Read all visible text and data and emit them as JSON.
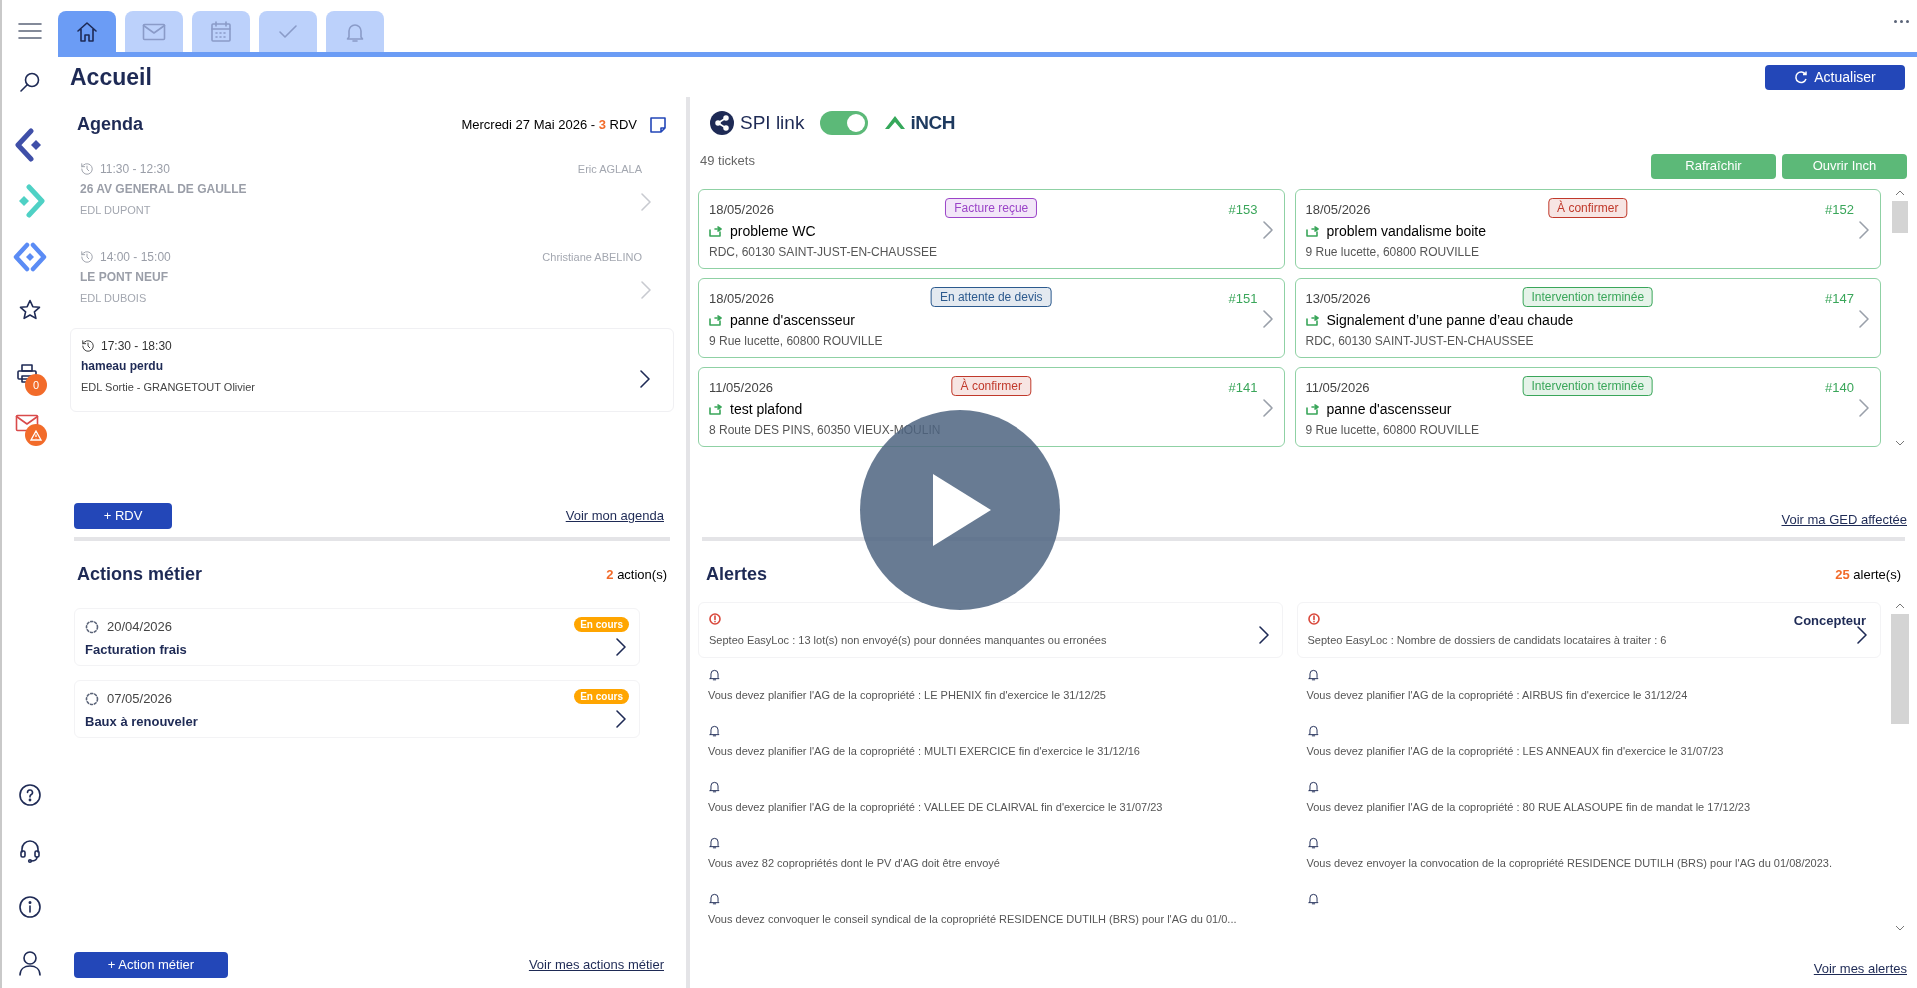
{
  "tabs": [
    {
      "kind": "home",
      "selected": true
    },
    {
      "kind": "mail",
      "selected": false
    },
    {
      "kind": "calendar",
      "selected": false
    },
    {
      "kind": "check",
      "selected": false
    },
    {
      "kind": "bell",
      "selected": false
    }
  ],
  "sidebar": {
    "print_badge": "0"
  },
  "page_title": "Accueil",
  "refresh_button": "Actualiser",
  "agenda": {
    "title": "Agenda",
    "date": "Mercredi 27 Mai 2026 -",
    "count": "3",
    "count_suffix": "RDV",
    "events": [
      {
        "time": "11:30 - 12:30",
        "person": "Eric AGLALA",
        "place": "26 AV GENERAL DE GAULLE",
        "detail": "EDL DUPONT",
        "past": true
      },
      {
        "time": "14:00 - 15:00",
        "person": "Christiane ABELINO",
        "place": "LE PONT NEUF",
        "detail": "EDL DUBOIS",
        "past": true
      },
      {
        "time": "17:30 - 18:30",
        "place": "hameau perdu",
        "detail": "EDL Sortie - GRANGETOUT Olivier",
        "past": false
      }
    ],
    "add_button": "+ RDV",
    "link": "Voir mon agenda"
  },
  "tickets": {
    "brand": "SPI link",
    "sync_on": true,
    "partner": "iNCH",
    "count": "49 tickets",
    "buttons": [
      "Rafraîchir",
      "Ouvrir Inch"
    ],
    "items": [
      {
        "date": "18/05/2026",
        "status": "Facture reçue",
        "color": "#9b44c8",
        "number": "#153",
        "title": "probleme WC",
        "address": "RDC, 60130 SAINT-JUST-EN-CHAUSSEE"
      },
      {
        "date": "18/05/2026",
        "status": "À confirmer",
        "color": "#c0392b",
        "number": "#152",
        "title": "problem vandalisme boite",
        "address": "9 Rue lucette, 60800 ROUVILLE"
      },
      {
        "date": "18/05/2026",
        "status": "En attente de devis",
        "color": "#2c5a8e",
        "number": "#151",
        "title": "panne d'ascensseur",
        "address": "9 Rue lucette, 60800 ROUVILLE"
      },
      {
        "date": "13/05/2026",
        "status": "Intervention terminée",
        "color": "#3aa65a",
        "number": "#147",
        "title": "Signalement d’une panne d’eau chaude",
        "address": "RDC, 60130 SAINT-JUST-EN-CHAUSSEE"
      },
      {
        "date": "11/05/2026",
        "status": "À confirmer",
        "color": "#c0392b",
        "number": "#141",
        "title": "test plafond",
        "address": "8 Route DES PINS, 60350 VIEUX-MOULIN"
      },
      {
        "date": "11/05/2026",
        "status": "Intervention terminée",
        "color": "#3aa65a",
        "number": "#140",
        "title": "panne d'ascensseur",
        "address": "9 Rue lucette, 60800 ROUVILLE"
      }
    ],
    "link": "Voir ma GED affectée"
  },
  "actions": {
    "title": "Actions métier",
    "count": "2",
    "count_suffix": "action(s)",
    "items": [
      {
        "date": "20/04/2026",
        "title": "Facturation frais",
        "status": "En cours"
      },
      {
        "date": "07/05/2026",
        "title": "Baux à renouveler",
        "status": "En cours"
      }
    ],
    "add_button": "+ Action métier",
    "link": "Voir mes actions métier"
  },
  "alerts": {
    "title": "Alertes",
    "count": "25",
    "count_suffix": "alerte(s)",
    "columns": [
      [
        {
          "kind": "error",
          "text": "Septeo EasyLoc : 13 lot(s) non envoyé(s) pour données manquantes ou erronées"
        },
        {
          "kind": "reminder",
          "text": "Vous devez planifier l'AG de la copropriété : LE PHENIX fin d'exercice le 31/12/25"
        },
        {
          "kind": "reminder",
          "text": "Vous devez planifier l'AG de la copropriété : MULTI EXERCICE fin d'exercice le 31/12/16"
        },
        {
          "kind": "reminder",
          "text": "Vous devez planifier l'AG de la copropriété : VALLEE DE CLAIRVAL fin d'exercice le 31/07/23"
        },
        {
          "kind": "reminder",
          "text": "Vous avez 82 copropriétés dont le PV d'AG doit être envoyé"
        },
        {
          "kind": "reminder",
          "text": "Vous devez convoquer le conseil syndical de la copropriété RESIDENCE DUTILH (BRS) pour l'AG du 01/0..."
        }
      ],
      [
        {
          "kind": "error",
          "text": "Septeo EasyLoc : Nombre de dossiers de candidats locataires à traiter : 6",
          "tag": "Concepteur"
        },
        {
          "kind": "reminder",
          "text": "Vous devez planifier l'AG de la copropriété : AIRBUS fin d'exercice le 31/12/24"
        },
        {
          "kind": "reminder",
          "text": "Vous devez planifier l'AG de la copropriété : LES ANNEAUX  fin d'exercice le 31/07/23"
        },
        {
          "kind": "reminder",
          "text": "Vous devez planifier l'AG de la copropriété : 80 RUE ALASOUPE fin de mandat  le 17/12/23"
        },
        {
          "kind": "reminder",
          "text": "Vous devez envoyer la convocation de la copropriété RESIDENCE DUTILH (BRS) pour l'AG du 01/08/2023."
        },
        {
          "kind": "reminder"
        }
      ]
    ],
    "link": "Voir mes alertes"
  }
}
